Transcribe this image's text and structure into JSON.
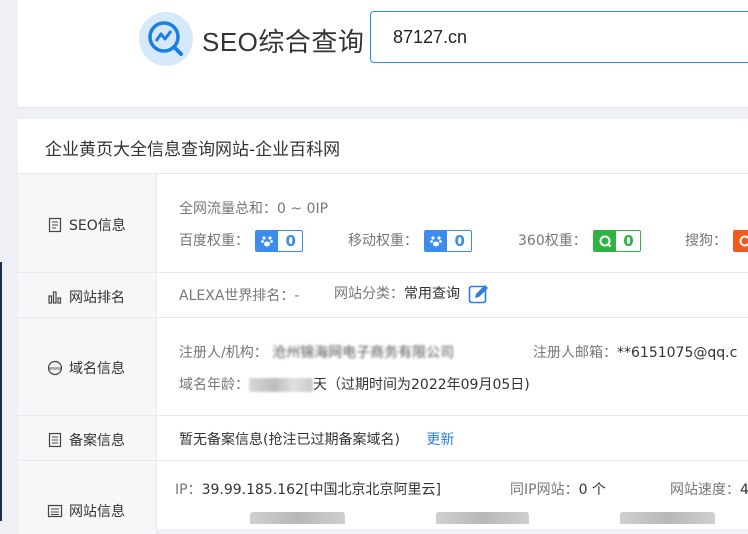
{
  "header": {
    "logo_text": "SEO综合查询",
    "search_value": "87127.cn"
  },
  "card": {
    "title": "企业黄页大全信息查询网站-企业百科网"
  },
  "rows": {
    "seo": {
      "label": "SEO信息",
      "traffic_label": "全网流量总和：",
      "traffic_value": "0 ~ 0IP",
      "baidu_label": "百度权重：",
      "baidu_value": "0",
      "mobile_label": "移动权重：",
      "mobile_value": "0",
      "s360_label": "360权重：",
      "s360_value": "0",
      "sogou_label": "搜狗："
    },
    "rank": {
      "label": "网站排名",
      "alexa_label": "ALEXA世界排名：",
      "alexa_value": "-",
      "category_label": "网站分类：",
      "category_value": "常用查询"
    },
    "domain": {
      "label": "域名信息",
      "registrant_label": "注册人/机构：",
      "registrant_value": "沧州锦海网电子商务有限公司",
      "email_label": "注册人邮箱：",
      "email_value": "**6151075@qq.c",
      "age_label": "域名年龄：",
      "age_suffix": "天（过期时间为2022年09月05日)"
    },
    "icp": {
      "label": "备案信息",
      "value": "暂无备案信息(抢注已过期备案域名)",
      "update_link": "更新"
    },
    "site": {
      "label": "网站信息",
      "ip_label": "IP：",
      "ip_value": "39.99.185.162[中国北京北京阿里云]",
      "same_ip_label": "同IP网站：",
      "same_ip_value": "0 个",
      "speed_label": "网站速度：",
      "speed_value": "4"
    }
  },
  "colors": {
    "accent": "#2b8cf0",
    "baidu": "#3b8ded",
    "s360": "#2fb344",
    "sogou": "#f05a1e"
  }
}
